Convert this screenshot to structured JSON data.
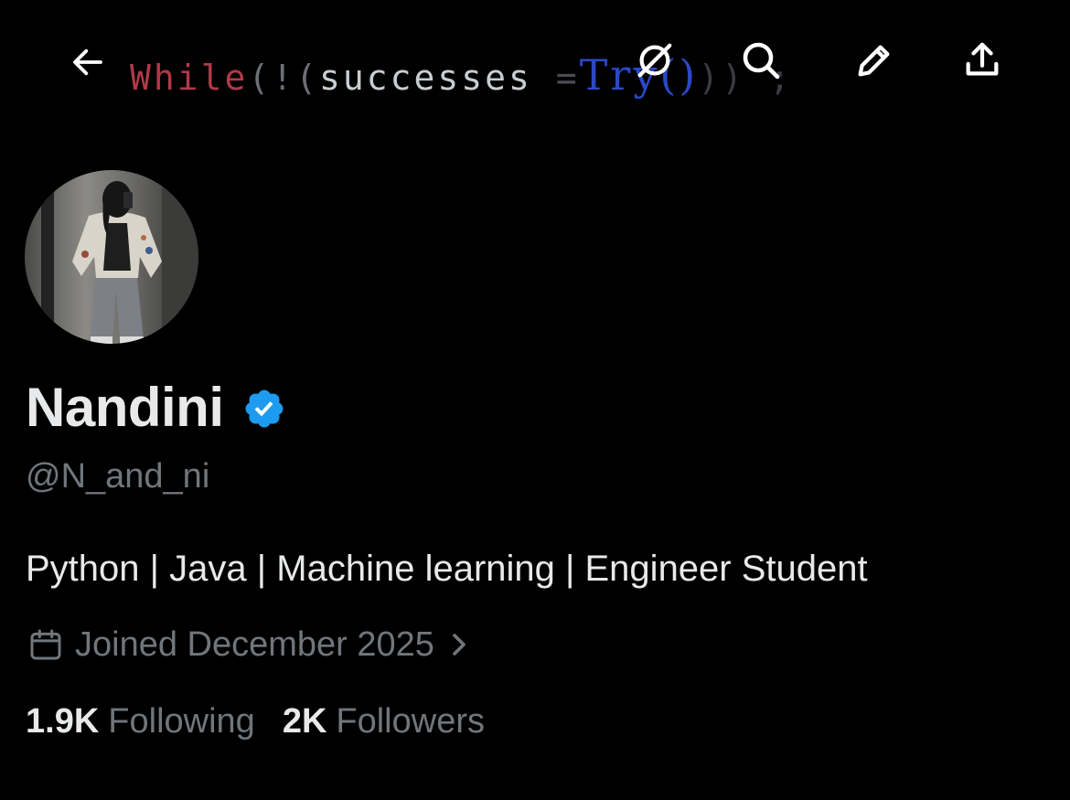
{
  "banner": {
    "code_keyword": "While",
    "code_open": "(!(",
    "code_ident": "successes",
    "code_op": " =",
    "code_call": "Try()",
    "code_close": ")",
    "code_tail": ")",
    "code_semicolon": ";"
  },
  "nav": {
    "back_icon": "arrow-left-icon",
    "grok_icon": "slashed-circle-icon",
    "search_icon": "search-icon",
    "edit_icon": "pencil-icon",
    "share_icon": "share-upload-icon"
  },
  "profile": {
    "display_name": "Nandini",
    "verified_badge_color": "#1d9bf0",
    "handle": "@N_and_ni",
    "bio": "Python | Java | Machine learning | Engineer Student",
    "joined": "Joined December 2025",
    "following_count": "1.9K",
    "following_label": "Following",
    "followers_count": "2K",
    "followers_label": "Followers"
  },
  "colors": {
    "background": "#000000",
    "primary_text": "#e7e9ea",
    "secondary_text": "#71767b",
    "accent_blue": "#1d9bf0"
  }
}
